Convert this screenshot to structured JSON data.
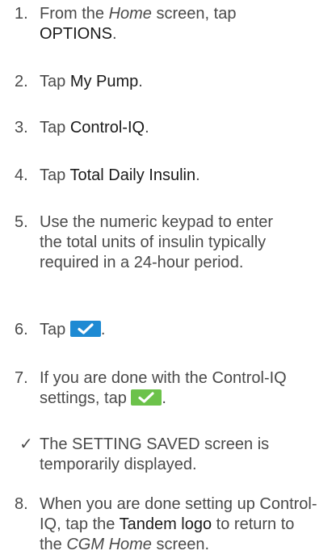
{
  "steps": [
    {
      "number": "1.",
      "parts": [
        "From the ",
        "Home",
        " screen, tap ",
        "OPTIONS",
        "."
      ]
    },
    {
      "number": "2.",
      "parts": [
        "Tap ",
        "My Pump",
        "."
      ]
    },
    {
      "number": "3.",
      "parts": [
        "Tap ",
        "Control-IQ",
        "."
      ]
    },
    {
      "number": "4.",
      "parts": [
        "Tap ",
        "Total Daily Insulin",
        "."
      ]
    },
    {
      "number": "5.",
      "parts": [
        "Use the numeric keypad to enter the total units of insulin typically required in a 24-hour period."
      ]
    },
    {
      "number": "6.",
      "parts": [
        "Tap ",
        "."
      ],
      "icon": "checkmark-button-icon",
      "icon_color": "#1e8ad3"
    },
    {
      "number": "7.",
      "parts": [
        "If you are done with the Control-IQ settings, tap ",
        "."
      ],
      "icon": "checkmark-button-icon",
      "icon_color": "#6cc24a"
    },
    {
      "number": "✓",
      "parts": [
        "The SETTING SAVED screen is temporarily displayed."
      ]
    },
    {
      "number": "8.",
      "parts": [
        "When you are done setting up Control-IQ, tap the ",
        "Tandem logo",
        " to return to the ",
        "CGM Home",
        " screen."
      ]
    }
  ]
}
